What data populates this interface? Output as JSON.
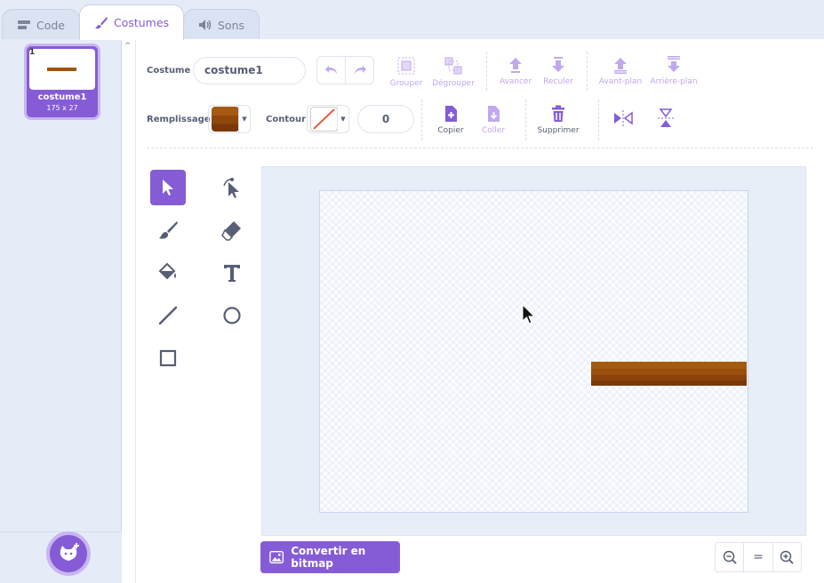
{
  "tabs": {
    "code": "Code",
    "costumes": "Costumes",
    "sounds": "Sons"
  },
  "costume_list": {
    "items": [
      {
        "number": "1",
        "name": "costume1",
        "size": "175 x 27"
      }
    ]
  },
  "toolbar": {
    "costume_label": "Costume",
    "costume_name": "costume1",
    "group": "Grouper",
    "ungroup": "Dégrouper",
    "forward": "Avancer",
    "backward": "Reculer",
    "front": "Avant-plan",
    "back": "Arrière-plan",
    "fill_label": "Remplissage",
    "outline_label": "Contour",
    "outline_size": "0",
    "copy": "Copier",
    "paste": "Coller",
    "delete": "Supprimer"
  },
  "bottom": {
    "convert": "Convertir en bitmap",
    "zoom_reset": "="
  },
  "colors": {
    "accent": "#855cd6",
    "fill": "#a0540f"
  }
}
